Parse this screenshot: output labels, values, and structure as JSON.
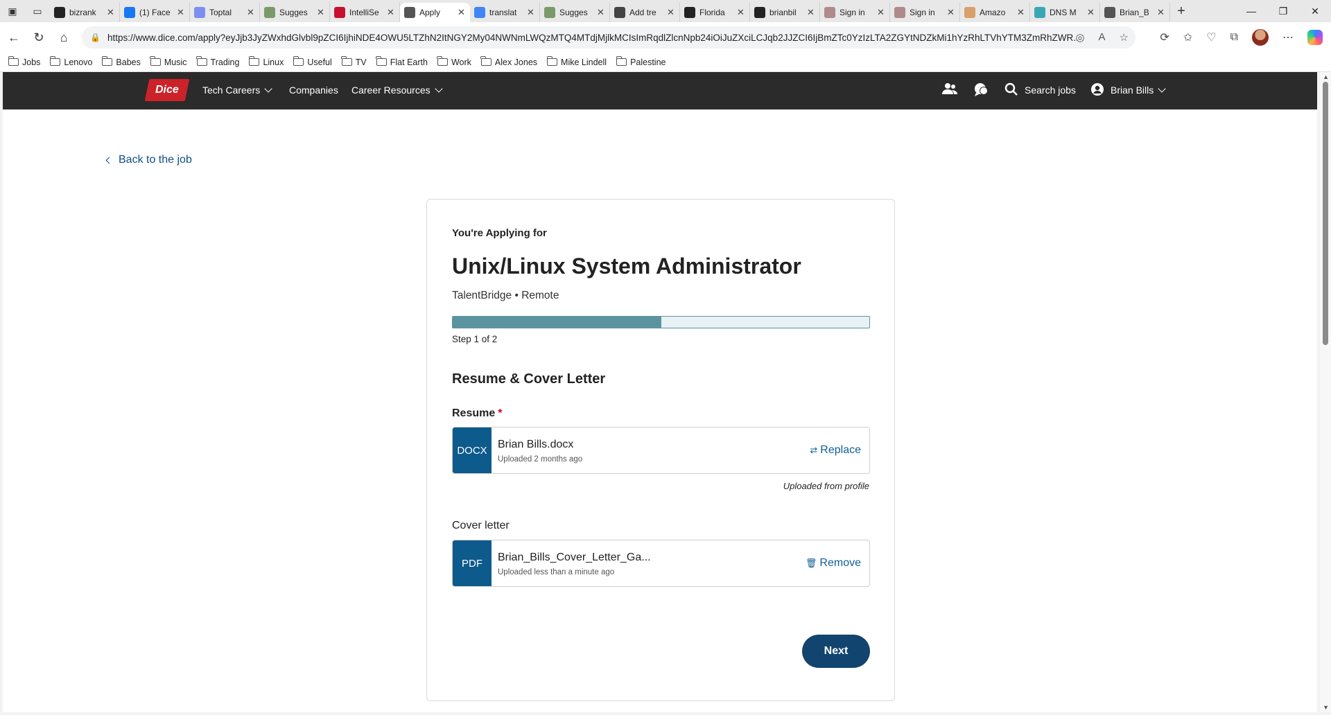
{
  "browser": {
    "tabs": [
      {
        "label": "bizrank",
        "icon": "github-icon",
        "color": "#222222"
      },
      {
        "label": "(1) Face",
        "icon": "facebook-icon",
        "color": "#1877f2"
      },
      {
        "label": "Toptal",
        "icon": "toptal-icon",
        "color": "#7c8ff0"
      },
      {
        "label": "Sugges",
        "icon": "suggest-icon",
        "color": "#7a9a6a"
      },
      {
        "label": "IntelliSe",
        "icon": "intellisearch-icon",
        "color": "#c8102e"
      },
      {
        "label": "Apply",
        "icon": "globe-icon",
        "color": "#555555"
      },
      {
        "label": "translat",
        "icon": "google-icon",
        "color": "#4285f4"
      },
      {
        "label": "Sugges",
        "icon": "suggest-icon",
        "color": "#7a9a6a"
      },
      {
        "label": "Add tre",
        "icon": "dev-icon",
        "color": "#444444"
      },
      {
        "label": "Florida",
        "icon": "threads-icon",
        "color": "#222222"
      },
      {
        "label": "brianbil",
        "icon": "github-icon",
        "color": "#222222"
      },
      {
        "label": "Sign in",
        "icon": "signin-icon",
        "color": "#b08a8a"
      },
      {
        "label": "Sign in",
        "icon": "signin-icon",
        "color": "#b08a8a"
      },
      {
        "label": "Amazo",
        "icon": "amazon-icon",
        "color": "#d8a06a"
      },
      {
        "label": "DNS M",
        "icon": "dns-icon",
        "color": "#3aa7b5"
      },
      {
        "label": "Brian_B",
        "icon": "globe-icon",
        "color": "#555555"
      }
    ],
    "active_tab_index": 5,
    "url": "https://www.dice.com/apply?eyJjb3JyZWxhdGlvbl9pZCI6IjhiNDE4OWU5LTZhN2ItNGY2My04NWNmLWQzMTQ4MTdjMjlkMCIsImRqdlZlcnNpb24iOiJuZXciLCJqb2JJZCI6IjBmZTc0YzIzLTA2ZGYtNDZkMi1hYzRhLTVhYTM3ZmRhZWR...",
    "bookmarks": [
      "Jobs",
      "Lenovo",
      "Babes",
      "Music",
      "Trading",
      "Linux",
      "Useful",
      "TV",
      "Flat Earth",
      "Work",
      "Alex Jones",
      "Mike Lindell",
      "Palestine"
    ]
  },
  "header": {
    "logo": "Dice",
    "nav": {
      "tech_careers": "Tech Careers",
      "companies": "Companies",
      "career_resources": "Career Resources"
    },
    "search_jobs": "Search jobs",
    "user_name": "Brian Bills"
  },
  "back_link": "Back to the job",
  "application": {
    "applying_for": "You're Applying for",
    "job_title": "Unix/Linux System Administrator",
    "company_location": "TalentBridge • Remote",
    "progress_fraction": 0.5,
    "step_text": "Step 1 of 2",
    "section_title": "Resume & Cover Letter",
    "resume": {
      "label": "Resume",
      "required_mark": "*",
      "file_type": "DOCX",
      "file_name": "Brian Bills.docx",
      "uploaded": "Uploaded 2 months ago",
      "action": "Replace",
      "source_note": "Uploaded from profile"
    },
    "cover_letter": {
      "label": "Cover letter",
      "file_type": "PDF",
      "file_name": "Brian_Bills_Cover_Letter_Ga...",
      "uploaded": "Uploaded less than a minute ago",
      "action": "Remove"
    },
    "next_button": "Next"
  }
}
